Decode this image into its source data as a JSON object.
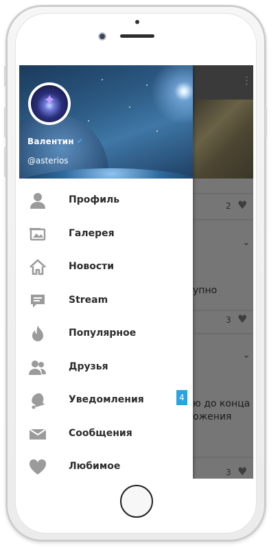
{
  "profile": {
    "name": "Валентин",
    "handle": "@asterios"
  },
  "menu": [
    {
      "label": "Профиль",
      "icon": "user-icon"
    },
    {
      "label": "Галерея",
      "icon": "gallery-icon"
    },
    {
      "label": "Новости",
      "icon": "home-icon"
    },
    {
      "label": "Stream",
      "icon": "chat-icon"
    },
    {
      "label": "Популярное",
      "icon": "flame-icon"
    },
    {
      "label": "Друзья",
      "icon": "friends-icon"
    },
    {
      "label": "Уведомления",
      "icon": "bell-icon",
      "badge": "4"
    },
    {
      "label": "Сообщения",
      "icon": "envelope-icon"
    },
    {
      "label": "Любимое",
      "icon": "heart-icon"
    }
  ],
  "background": {
    "post1_count": "2",
    "post2_text": "упно",
    "post2_count": "3",
    "post3_line1": "ю до конца",
    "post3_line2": "ожения",
    "post3_count": "3"
  },
  "colors": {
    "badge": "#2da2e0",
    "verified": "#4aa0ea"
  }
}
